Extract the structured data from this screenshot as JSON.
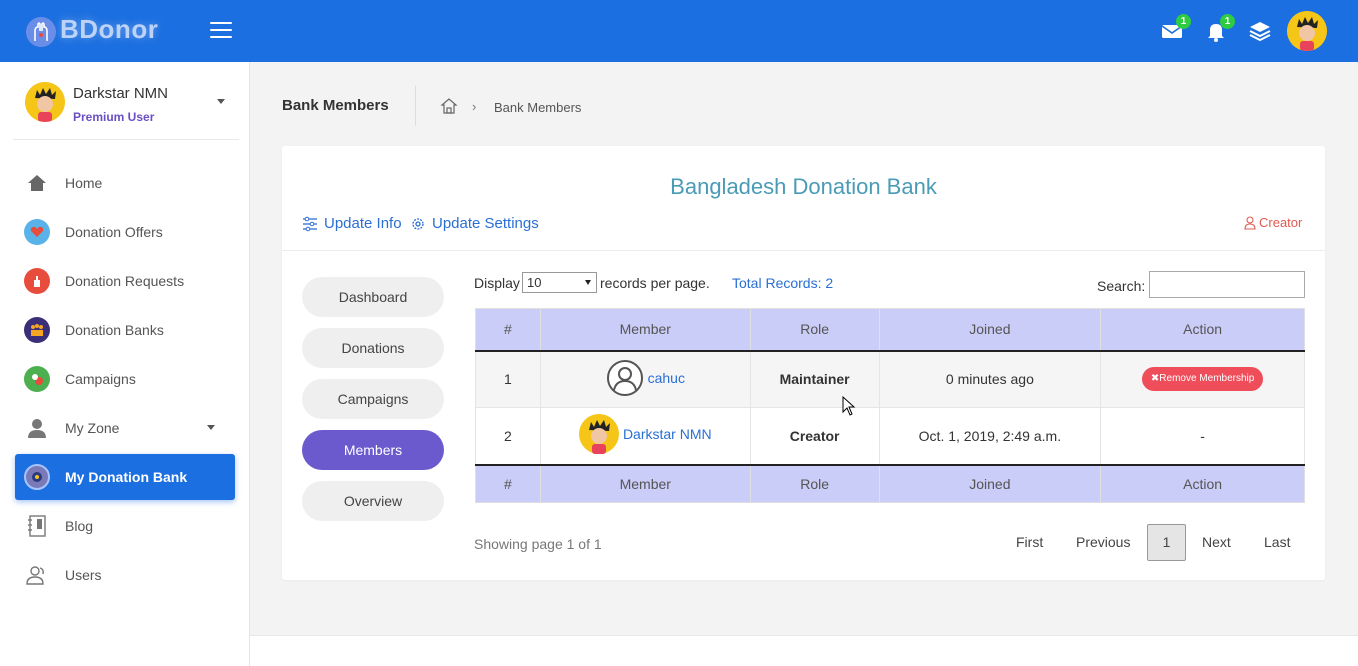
{
  "brand": {
    "name": "BDonor"
  },
  "topbar": {
    "mail_badge": "1",
    "notif_badge": "1"
  },
  "user": {
    "name": "Darkstar NMN",
    "role": "Premium User"
  },
  "sidebar": {
    "items": [
      {
        "label": "Home",
        "icon": "home-icon"
      },
      {
        "label": "Donation Offers",
        "icon": "heart-hand-icon"
      },
      {
        "label": "Donation Requests",
        "icon": "hand-request-icon"
      },
      {
        "label": "Donation Banks",
        "icon": "people-bank-icon"
      },
      {
        "label": "Campaigns",
        "icon": "campaign-icon"
      },
      {
        "label": "My Zone",
        "icon": "user-icon"
      },
      {
        "label": "My Donation Bank",
        "icon": "bank-badge-icon"
      },
      {
        "label": "Blog",
        "icon": "notebook-icon"
      },
      {
        "label": "Users",
        "icon": "users-icon"
      }
    ]
  },
  "page": {
    "title": "Bank Members",
    "breadcrumb_current": "Bank Members"
  },
  "card": {
    "bank_title": "Bangladesh Donation Bank",
    "update_info": "Update Info",
    "update_settings": "Update Settings",
    "creator_label": "Creator"
  },
  "side_nav": {
    "dashboard": "Dashboard",
    "donations": "Donations",
    "campaigns": "Campaigns",
    "members": "Members",
    "overview": "Overview"
  },
  "table_controls": {
    "display_label": "Display",
    "display_value": "10",
    "per_page": "records per page.",
    "total_records": "Total Records: 2",
    "search_label": "Search:"
  },
  "table": {
    "headers": {
      "num": "#",
      "member": "Member",
      "role": "Role",
      "joined": "Joined",
      "action": "Action"
    },
    "rows": [
      {
        "num": "1",
        "member": "cahuc",
        "role": "Maintainer",
        "joined": "0 minutes ago",
        "action": "Remove Membership"
      },
      {
        "num": "2",
        "member": "Darkstar NMN",
        "role": "Creator",
        "joined": "Oct. 1, 2019, 2:49 a.m.",
        "action": "-"
      }
    ]
  },
  "pagination": {
    "showing": "Showing page 1 of 1",
    "first": "First",
    "previous": "Previous",
    "current": "1",
    "next": "Next",
    "last": "Last"
  },
  "colors": {
    "primary": "#1c6fe0",
    "accent": "#6a5acd",
    "danger": "#ef4d5a",
    "success": "#3aab3a"
  }
}
